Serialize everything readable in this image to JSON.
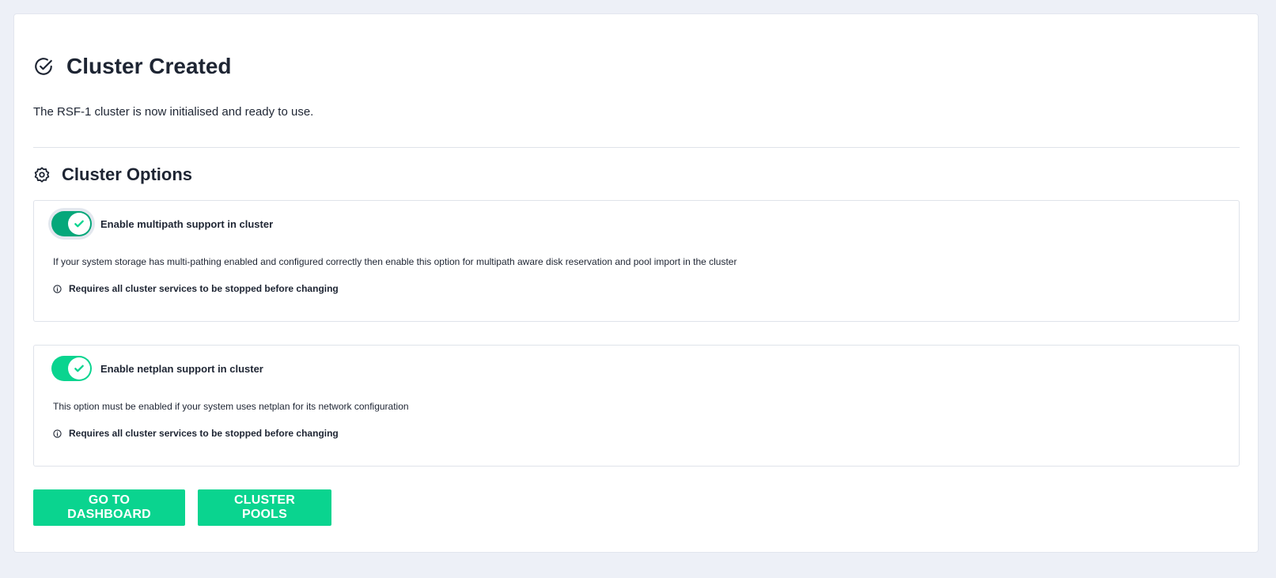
{
  "header": {
    "title": "Cluster Created",
    "icon": "check-circle-icon",
    "intro": "The RSF-1 cluster is now initialised and ready to use."
  },
  "options_section": {
    "title": "Cluster Options",
    "icon": "gear-icon",
    "items": [
      {
        "label": "Enable multipath support in cluster",
        "enabled": true,
        "description": "If your system storage has multi-pathing enabled and configured correctly then enable this option for multipath aware disk reservation and pool import in the cluster",
        "warning": "Requires all cluster services to be stopped before changing"
      },
      {
        "label": "Enable netplan support in cluster",
        "enabled": true,
        "description": "This option must be enabled if your system uses netplan for its network configuration",
        "warning": "Requires all cluster services to be stopped before changing"
      }
    ]
  },
  "actions": {
    "dashboard_label": "GO TO DASHBOARD",
    "pools_label": "CLUSTER POOLS"
  },
  "colors": {
    "accent": "#0ad48f",
    "accent_dark": "#05a77a",
    "text": "#1e2533",
    "background": "#edf0f7"
  }
}
